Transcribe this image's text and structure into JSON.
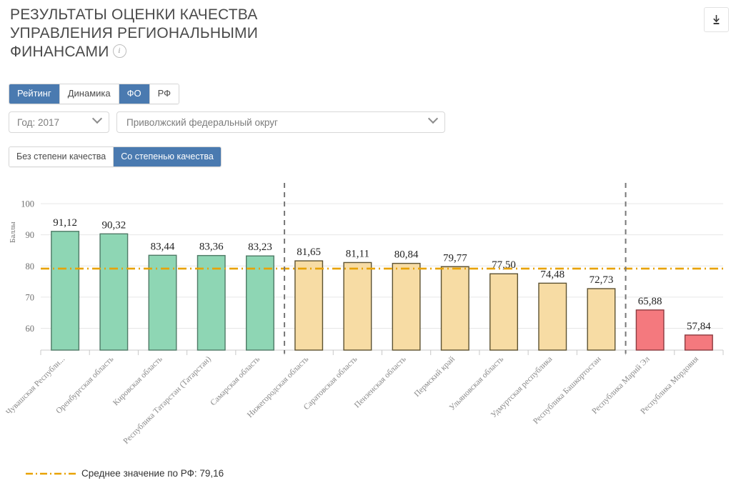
{
  "header": {
    "title_line1": "РЕЗУЛЬТАТЫ ОЦЕНКИ КАЧЕСТВА",
    "title_line2": "УПРАВЛЕНИЯ РЕГИОНАЛЬНЫМИ",
    "title_line3": "ФИНАНСАМИ",
    "info_glyph": "i",
    "download_label": "download-icon"
  },
  "tabs": [
    {
      "label": "Рейтинг",
      "active": true
    },
    {
      "label": "Динамика",
      "active": false
    },
    {
      "label": "ФО",
      "active": true
    },
    {
      "label": "РФ",
      "active": false
    }
  ],
  "selects": {
    "year": {
      "value": "Год: 2017"
    },
    "okrug": {
      "value": "Приволжский федеральный округ"
    }
  },
  "quality_toggle": [
    {
      "label": "Без степени качества",
      "active": false
    },
    {
      "label": "Со степенью качества",
      "active": true
    }
  ],
  "colors": {
    "accent": "#4a7ab0",
    "green_fill": "#8ed6b4",
    "green_stroke": "#4f7a66",
    "tan_fill": "#f7dca4",
    "tan_stroke": "#5d5231",
    "red_fill": "#f4797e",
    "red_stroke": "#8c3b40",
    "average_line": "#e8a200",
    "grid": "#e6e6e6",
    "axis": "#c8c8c8",
    "separator": "#777777"
  },
  "chart_data": {
    "type": "bar",
    "title": "РЕЗУЛЬТАТЫ ОЦЕНКИ КАЧЕСТВА УПРАВЛЕНИЯ РЕГИОНАЛЬНЫМИ ФИНАНСАМИ",
    "xlabel": "",
    "ylabel": "Баллы",
    "ylim": [
      53,
      103
    ],
    "yticks": [
      60,
      70,
      80,
      90,
      100
    ],
    "grid": true,
    "legend_position": "bottom-left",
    "categories": [
      "Чувашская Республи...",
      "Оренбургская область",
      "Кировская область",
      "Республика Татарстан (Татарстан)",
      "Самарская область",
      "Нижегородская область",
      "Саратовская область",
      "Пензенская область",
      "Пермский край",
      "Ульяновская область",
      "Удмуртская республика",
      "Республика Башкортостан",
      "Республика Марий Эл",
      "Республика Мордовия"
    ],
    "values": [
      91.12,
      90.32,
      83.44,
      83.36,
      83.23,
      81.65,
      81.11,
      80.84,
      79.77,
      77.5,
      74.48,
      72.73,
      65.88,
      57.84
    ],
    "value_labels": [
      "91,12",
      "90,32",
      "83,44",
      "83,36",
      "83,23",
      "81,65",
      "81,11",
      "80,84",
      "79,77",
      "77,50",
      "74,48",
      "72,73",
      "65,88",
      "57,84"
    ],
    "groups": [
      "green",
      "green",
      "green",
      "green",
      "green",
      "tan",
      "tan",
      "tan",
      "tan",
      "tan",
      "tan",
      "tan",
      "red",
      "red"
    ],
    "group_separators_after_index": [
      4,
      11
    ],
    "average_line": {
      "value": 79.16,
      "label": "Среднее значение по РФ: 79,16",
      "style": "dash-dot"
    }
  }
}
